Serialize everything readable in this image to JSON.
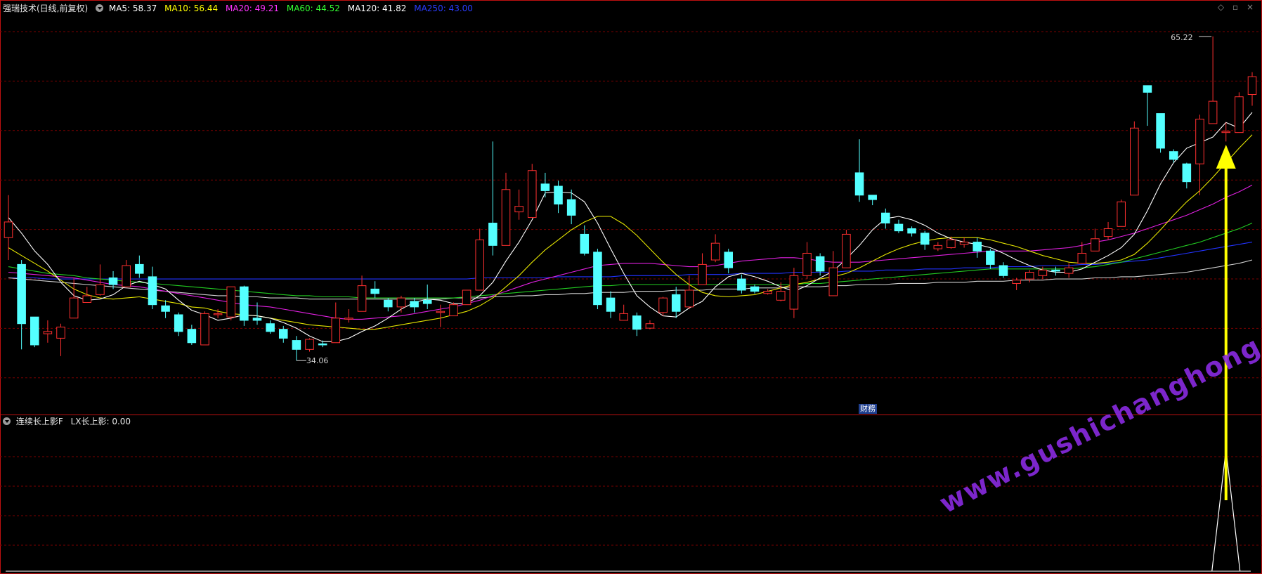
{
  "main_legend": {
    "name": "强瑞技术(日线,前复权)",
    "ma5": {
      "label": "MA5: 58.37",
      "color": "#ffffff"
    },
    "ma10": {
      "label": "MA10: 56.44",
      "color": "#ffff00"
    },
    "ma20": {
      "label": "MA20: 49.21",
      "color": "#ff00ff"
    },
    "ma60": {
      "label": "MA60: 44.52",
      "color": "#00ff00"
    },
    "ma120": {
      "label": "MA120: 41.82",
      "color": "#ffffff"
    },
    "ma250": {
      "label": "MA250: 43.00",
      "color": "#0000ff"
    }
  },
  "sub_legend": {
    "name": "连续长上影F",
    "value": "LX长上影: 0.00"
  },
  "badge": "财務",
  "watermark": "www.gushichanghong.com",
  "icons": [
    "diamond-icon",
    "restore-icon",
    "close-icon"
  ],
  "colors": {
    "up": "#ff3030",
    "down": "#54ffff",
    "grid": "#7a0000",
    "border": "#c01010",
    "arrow": "#ffff00"
  },
  "chart_data": {
    "type": "candlestick",
    "price_range": [
      31.5,
      67.2
    ],
    "high_label": "65.22",
    "low_label": "34.06",
    "candles": [
      [
        47.2,
        48.6,
        45.2,
        51.0
      ],
      [
        44.8,
        39.5,
        37.2,
        45.2
      ],
      [
        40.1,
        37.6,
        37.4,
        40.1
      ],
      [
        38.6,
        38.8,
        37.8,
        39.8
      ],
      [
        38.2,
        39.2,
        36.6,
        39.5
      ],
      [
        40.0,
        41.8,
        40.0,
        43.6
      ],
      [
        41.4,
        42.0,
        41.4,
        42.8
      ],
      [
        42.1,
        43.0,
        42.0,
        44.8
      ],
      [
        43.6,
        43.0,
        42.6,
        44.2
      ],
      [
        42.8,
        44.7,
        42.8,
        45.2
      ],
      [
        44.8,
        44.0,
        43.6,
        45.6
      ],
      [
        43.7,
        41.2,
        40.8,
        44.6
      ],
      [
        41.1,
        40.6,
        40.0,
        41.6
      ],
      [
        40.3,
        38.8,
        38.4,
        40.5
      ],
      [
        39.0,
        37.8,
        37.6,
        39.4
      ],
      [
        37.6,
        40.4,
        37.6,
        40.6
      ],
      [
        40.4,
        40.4,
        40.0,
        40.8
      ],
      [
        40.1,
        42.8,
        39.8,
        42.8
      ],
      [
        42.8,
        39.8,
        39.3,
        42.9
      ],
      [
        40.0,
        39.8,
        39.4,
        41.4
      ],
      [
        39.5,
        38.8,
        38.6,
        39.8
      ],
      [
        39.0,
        38.2,
        37.8,
        39.3
      ],
      [
        38.0,
        37.2,
        36.2,
        38.4
      ],
      [
        37.2,
        38.1,
        37.0,
        38.2
      ],
      [
        37.7,
        37.6,
        37.4,
        38.0
      ],
      [
        37.8,
        40.0,
        37.8,
        41.4
      ],
      [
        40.0,
        40.0,
        39.6,
        40.8
      ],
      [
        40.6,
        42.9,
        40.6,
        43.8
      ],
      [
        42.6,
        42.2,
        41.8,
        43.3
      ],
      [
        41.6,
        41.0,
        40.6,
        41.8
      ],
      [
        41.0,
        41.8,
        40.5,
        42.0
      ],
      [
        41.5,
        41.0,
        40.5,
        41.8
      ],
      [
        41.6,
        41.3,
        40.8,
        43.0
      ],
      [
        40.6,
        40.6,
        39.2,
        41.2
      ],
      [
        40.2,
        41.2,
        40.2,
        41.4
      ],
      [
        41.2,
        42.5,
        41.2,
        42.5
      ],
      [
        42.5,
        47.0,
        42.5,
        48.0
      ],
      [
        48.5,
        46.5,
        45.6,
        55.8
      ],
      [
        46.5,
        51.5,
        46.5,
        53.0
      ],
      [
        49.5,
        50.0,
        48.8,
        51.5
      ],
      [
        49.0,
        53.2,
        49.0,
        53.8
      ],
      [
        52.0,
        51.4,
        50.8,
        53.0
      ],
      [
        51.8,
        50.2,
        49.4,
        52.3
      ],
      [
        50.6,
        49.2,
        48.4,
        51.5
      ],
      [
        47.5,
        45.8,
        45.6,
        48.3
      ],
      [
        45.9,
        41.2,
        40.8,
        46.2
      ],
      [
        41.8,
        40.6,
        40.0,
        42.4
      ],
      [
        39.8,
        40.4,
        39.8,
        41.2
      ],
      [
        40.2,
        39.0,
        38.4,
        40.5
      ],
      [
        39.1,
        39.5,
        39.0,
        39.8
      ],
      [
        40.5,
        41.8,
        40.2,
        41.9
      ],
      [
        42.1,
        40.6,
        40.0,
        42.8
      ],
      [
        41.0,
        42.5,
        40.8,
        43.8
      ],
      [
        43.0,
        44.8,
        43.0,
        45.8
      ],
      [
        45.2,
        46.7,
        45.0,
        47.5
      ],
      [
        45.9,
        44.5,
        44.0,
        46.2
      ],
      [
        43.5,
        42.5,
        42.2,
        43.9
      ],
      [
        42.8,
        42.4,
        42.2,
        43.0
      ],
      [
        42.2,
        42.4,
        42.1,
        42.6
      ],
      [
        41.6,
        42.4,
        41.5,
        43.2
      ],
      [
        40.8,
        43.8,
        40.0,
        44.5
      ],
      [
        43.8,
        45.8,
        43.5,
        46.8
      ],
      [
        45.5,
        44.2,
        43.8,
        45.8
      ],
      [
        42.0,
        44.5,
        42.0,
        46.0
      ],
      [
        44.5,
        47.5,
        44.5,
        47.9
      ],
      [
        53.0,
        51.0,
        50.4,
        56.0
      ],
      [
        51.0,
        50.6,
        50.1,
        51.0
      ],
      [
        49.4,
        48.5,
        48.0,
        49.8
      ],
      [
        48.4,
        47.8,
        47.6,
        48.8
      ],
      [
        48.0,
        47.6,
        47.3,
        48.2
      ],
      [
        47.6,
        46.6,
        46.1,
        47.8
      ],
      [
        46.2,
        46.5,
        46.0,
        46.8
      ],
      [
        46.3,
        47.0,
        46.2,
        47.3
      ],
      [
        46.6,
        46.8,
        46.3,
        47.2
      ],
      [
        46.8,
        46.0,
        45.4,
        47.2
      ],
      [
        46.0,
        44.8,
        44.4,
        46.2
      ],
      [
        44.7,
        43.8,
        43.6,
        45.0
      ],
      [
        43.1,
        43.4,
        42.5,
        43.6
      ],
      [
        43.5,
        44.1,
        43.2,
        44.3
      ],
      [
        43.8,
        44.3,
        43.5,
        44.6
      ],
      [
        44.3,
        44.2,
        43.8,
        44.6
      ],
      [
        44.0,
        44.5,
        43.6,
        44.9
      ],
      [
        44.9,
        45.8,
        44.9,
        46.8
      ],
      [
        46.0,
        47.1,
        46.0,
        48.0
      ],
      [
        47.3,
        48.0,
        47.0,
        48.6
      ],
      [
        48.2,
        50.4,
        48.2,
        50.6
      ],
      [
        51.0,
        57.0,
        51.0,
        57.6
      ],
      [
        60.8,
        60.2,
        57.2,
        60.8
      ],
      [
        58.3,
        55.2,
        54.8,
        58.3
      ],
      [
        54.9,
        54.2,
        53.9,
        55.1
      ],
      [
        53.8,
        52.2,
        51.6,
        53.9
      ],
      [
        53.8,
        57.8,
        51.0,
        58.2
      ],
      [
        57.4,
        59.4,
        57.4,
        65.2
      ],
      [
        56.6,
        56.7,
        55.8,
        57.5
      ],
      [
        56.6,
        59.8,
        56.6,
        60.2
      ],
      [
        60.0,
        61.6,
        59.0,
        62.0
      ]
    ],
    "ma5": [
      49.0,
      47.6,
      46.0,
      44.8,
      43.2,
      42.0,
      41.6,
      41.7,
      42.1,
      42.9,
      43.3,
      43.0,
      42.6,
      41.6,
      40.7,
      40.3,
      39.8,
      40.0,
      40.3,
      40.2,
      40.0,
      39.6,
      39.1,
      38.4,
      37.9,
      37.9,
      38.2,
      38.8,
      39.3,
      40.0,
      40.8,
      41.4,
      41.7,
      41.6,
      41.3,
      41.3,
      42.0,
      43.2,
      45.1,
      46.8,
      48.8,
      51.2,
      51.3,
      51.2,
      50.4,
      48.5,
      46.2,
      44.0,
      42.0,
      41.0,
      40.2,
      40.1,
      40.9,
      41.5,
      42.8,
      43.7,
      44.0,
      43.7,
      43.3,
      42.8,
      42.4,
      42.9,
      43.6,
      44.2,
      45.3,
      46.5,
      47.9,
      48.9,
      49.1,
      48.8,
      48.3,
      47.6,
      47.1,
      46.8,
      46.6,
      46.3,
      45.8,
      45.2,
      44.7,
      44.3,
      44.1,
      44.1,
      44.4,
      45.0,
      45.6,
      46.3,
      47.5,
      49.6,
      52.0,
      53.9,
      55.2,
      55.7,
      56.2,
      57.5,
      57.0,
      58.4
    ],
    "ma10": [
      46.3,
      45.6,
      44.9,
      44.2,
      43.4,
      42.6,
      42.1,
      41.8,
      41.7,
      41.8,
      41.9,
      41.7,
      41.5,
      41.3,
      41.0,
      40.9,
      40.6,
      40.4,
      40.3,
      40.2,
      40.0,
      39.8,
      39.6,
      39.4,
      39.3,
      39.2,
      39.1,
      39.0,
      39.0,
      39.2,
      39.4,
      39.6,
      39.8,
      40.0,
      40.3,
      40.6,
      41.1,
      41.8,
      42.8,
      43.8,
      45.0,
      46.1,
      47.0,
      47.9,
      48.6,
      49.1,
      49.1,
      48.4,
      47.4,
      46.2,
      45.0,
      43.9,
      43.0,
      42.3,
      42.0,
      41.9,
      42.0,
      42.1,
      42.4,
      42.7,
      43.0,
      43.2,
      43.5,
      43.7,
      44.0,
      44.5,
      45.1,
      45.7,
      46.2,
      46.6,
      46.9,
      47.1,
      47.2,
      47.2,
      47.2,
      47.0,
      46.7,
      46.4,
      46.0,
      45.6,
      45.3,
      45.0,
      44.9,
      44.9,
      45.0,
      45.2,
      45.7,
      46.7,
      47.9,
      49.2,
      50.4,
      51.4,
      52.6,
      53.9,
      55.2,
      56.4
    ],
    "ma20": [
      44.1,
      44.0,
      43.9,
      43.8,
      43.7,
      43.6,
      43.4,
      43.2,
      43.0,
      42.9,
      42.8,
      42.6,
      42.4,
      42.2,
      42.0,
      41.8,
      41.6,
      41.4,
      41.2,
      41.1,
      41.0,
      40.8,
      40.6,
      40.4,
      40.2,
      40.0,
      39.9,
      39.9,
      40.0,
      40.1,
      40.2,
      40.4,
      40.6,
      40.8,
      41.0,
      41.3,
      41.6,
      42.0,
      42.4,
      42.8,
      43.2,
      43.5,
      43.8,
      44.1,
      44.4,
      44.7,
      44.8,
      44.9,
      44.9,
      44.9,
      44.8,
      44.7,
      44.6,
      44.6,
      44.7,
      44.9,
      45.1,
      45.2,
      45.3,
      45.4,
      45.4,
      45.3,
      45.1,
      45.0,
      45.0,
      45.0,
      45.1,
      45.2,
      45.3,
      45.4,
      45.5,
      45.6,
      45.7,
      45.8,
      45.9,
      46.0,
      46.0,
      46.0,
      46.0,
      46.1,
      46.2,
      46.3,
      46.5,
      46.8,
      47.0,
      47.3,
      47.6,
      48.0,
      48.4,
      48.8,
      49.2,
      49.7,
      50.2,
      50.8,
      51.3,
      51.9
    ],
    "ma60": [
      44.6,
      44.4,
      44.2,
      44.0,
      43.9,
      43.8,
      43.6,
      43.5,
      43.4,
      43.3,
      43.2,
      43.1,
      43.0,
      42.9,
      42.8,
      42.7,
      42.6,
      42.5,
      42.4,
      42.3,
      42.2,
      42.1,
      42.0,
      42.0,
      41.9,
      41.9,
      41.9,
      41.8,
      41.8,
      41.8,
      41.8,
      41.8,
      41.8,
      41.8,
      41.8,
      41.9,
      42.0,
      42.1,
      42.2,
      42.3,
      42.4,
      42.5,
      42.6,
      42.7,
      42.8,
      42.9,
      42.9,
      43.0,
      43.0,
      43.0,
      43.0,
      43.0,
      43.0,
      43.0,
      43.0,
      43.0,
      43.0,
      43.0,
      43.0,
      43.0,
      43.0,
      43.1,
      43.1,
      43.2,
      43.3,
      43.4,
      43.5,
      43.6,
      43.7,
      43.8,
      43.9,
      44.0,
      44.1,
      44.2,
      44.3,
      44.4,
      44.4,
      44.4,
      44.4,
      44.4,
      44.4,
      44.4,
      44.5,
      44.6,
      44.8,
      45.0,
      45.3,
      45.6,
      45.9,
      46.2,
      46.5,
      46.8,
      47.2,
      47.6,
      48.0,
      48.5
    ],
    "ma120": [
      43.6,
      43.5,
      43.4,
      43.3,
      43.2,
      43.1,
      43.0,
      42.9,
      42.8,
      42.7,
      42.6,
      42.5,
      42.4,
      42.3,
      42.2,
      42.1,
      42.0,
      42.0,
      41.9,
      41.9,
      41.8,
      41.8,
      41.8,
      41.7,
      41.7,
      41.7,
      41.7,
      41.7,
      41.7,
      41.7,
      41.7,
      41.7,
      41.7,
      41.7,
      41.8,
      41.8,
      41.8,
      41.9,
      41.9,
      42.0,
      42.0,
      42.1,
      42.1,
      42.2,
      42.2,
      42.3,
      42.3,
      42.3,
      42.4,
      42.4,
      42.4,
      42.5,
      42.5,
      42.5,
      42.6,
      42.6,
      42.6,
      42.7,
      42.7,
      42.7,
      42.8,
      42.8,
      42.8,
      42.9,
      42.9,
      43.0,
      43.0,
      43.0,
      43.1,
      43.1,
      43.1,
      43.2,
      43.2,
      43.2,
      43.3,
      43.3,
      43.3,
      43.4,
      43.4,
      43.4,
      43.5,
      43.5,
      43.5,
      43.6,
      43.6,
      43.7,
      43.7,
      43.8,
      43.9,
      44.0,
      44.1,
      44.3,
      44.5,
      44.7,
      44.9,
      45.2
    ],
    "ma250": [
      43.6,
      43.6,
      43.6,
      43.5,
      43.5,
      43.5,
      43.5,
      43.5,
      43.5,
      43.5,
      43.5,
      43.5,
      43.5,
      43.5,
      43.5,
      43.5,
      43.5,
      43.5,
      43.5,
      43.5,
      43.5,
      43.5,
      43.5,
      43.5,
      43.5,
      43.5,
      43.5,
      43.5,
      43.5,
      43.5,
      43.5,
      43.5,
      43.5,
      43.5,
      43.5,
      43.5,
      43.6,
      43.6,
      43.6,
      43.6,
      43.6,
      43.6,
      43.7,
      43.7,
      43.7,
      43.7,
      43.7,
      43.8,
      43.8,
      43.8,
      43.8,
      43.8,
      43.9,
      43.9,
      43.9,
      43.9,
      44.0,
      44.0,
      44.0,
      44.0,
      44.1,
      44.1,
      44.1,
      44.1,
      44.2,
      44.2,
      44.2,
      44.3,
      44.3,
      44.3,
      44.4,
      44.4,
      44.4,
      44.5,
      44.5,
      44.5,
      44.6,
      44.6,
      44.6,
      44.7,
      44.7,
      44.7,
      44.8,
      44.8,
      44.9,
      45.0,
      45.1,
      45.2,
      45.4,
      45.6,
      45.8,
      46.0,
      46.2,
      46.4,
      46.6,
      46.8
    ],
    "lx_signal": [
      0,
      0,
      0,
      0,
      0,
      0,
      0,
      0,
      0,
      0,
      0,
      0,
      0,
      0,
      0,
      0,
      0,
      0,
      0,
      0,
      0,
      0,
      0,
      0,
      0,
      0,
      0,
      0,
      0,
      0,
      0,
      0,
      0,
      0,
      0,
      0,
      0,
      0,
      0,
      0,
      0,
      0,
      0,
      0,
      0,
      0,
      0,
      0,
      0,
      0,
      0,
      0,
      0,
      0,
      0,
      0,
      0,
      0,
      0,
      0,
      0,
      0,
      0,
      0,
      0,
      0,
      0,
      0,
      0,
      0,
      0,
      0,
      0,
      0,
      0,
      0,
      0,
      0,
      0,
      0,
      0,
      0,
      0,
      0,
      0,
      0,
      0,
      0,
      0,
      0,
      0,
      0,
      0,
      1,
      0,
      0
    ],
    "lx_current": 0.0,
    "signal_index": 93
  }
}
